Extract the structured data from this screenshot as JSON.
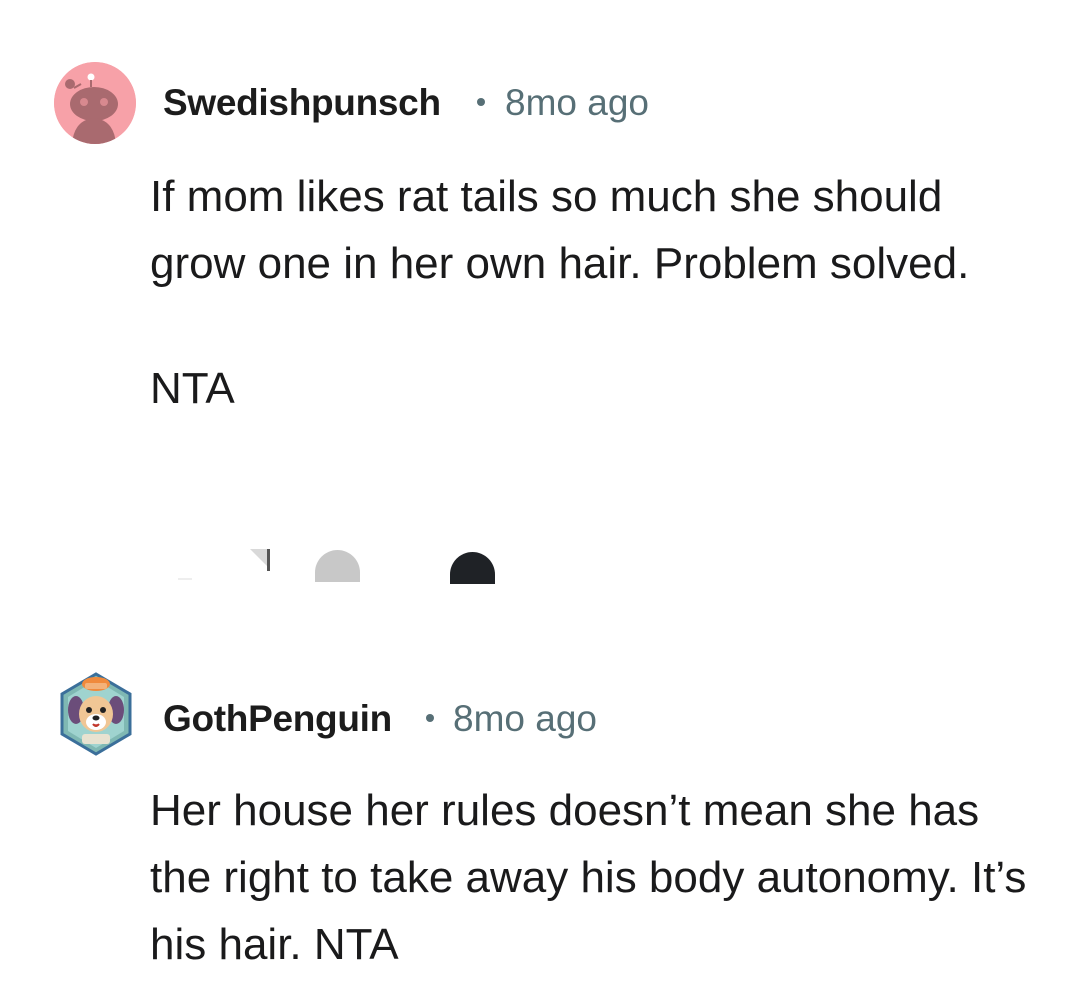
{
  "comments": [
    {
      "username": "Swedishpunsch",
      "timestamp": "8mo ago",
      "avatar_icon": "snoo-avatar-icon",
      "avatar_color": "#f7a1a8",
      "paragraphs": [
        "If mom likes rat tails so much she should grow one in her own hair. Problem solved.",
        "NTA"
      ]
    },
    {
      "username": "GothPenguin",
      "timestamp": "8mo ago",
      "avatar_icon": "dog-avatar-icon",
      "paragraphs": [
        "Her house her rules doesn’t mean she has the right to take away his body autonomy. It’s his hair. NTA"
      ]
    }
  ],
  "colors": {
    "text": "#1a1a1b",
    "meta": "#576f76"
  }
}
